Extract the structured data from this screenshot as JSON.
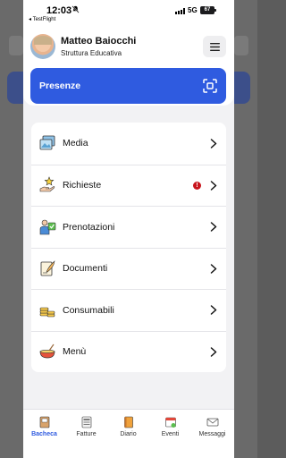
{
  "status_bar": {
    "time": "12:03",
    "silent_icon": "bell-slash",
    "back_app": "◂ TestFlight",
    "network": "5G",
    "battery": "67"
  },
  "header": {
    "user_name": "Matteo Baiocchi",
    "user_role": "Struttura Educativa",
    "menu_icon": "hamburger-icon"
  },
  "presence": {
    "label": "Presenze",
    "icon": "qr-scan-icon",
    "color": "#2f5be0"
  },
  "menu": {
    "items": [
      {
        "label": "Media",
        "icon": "photos-icon"
      },
      {
        "label": "Richieste",
        "icon": "star-hand-icon",
        "alert": "!"
      },
      {
        "label": "Prenotazioni",
        "icon": "person-check-icon"
      },
      {
        "label": "Documenti",
        "icon": "document-quill-icon"
      },
      {
        "label": "Consumabili",
        "icon": "coins-icon"
      },
      {
        "label": "Menù",
        "icon": "food-bowl-icon"
      }
    ]
  },
  "tab_bar": {
    "active": "Bacheca",
    "tabs": [
      {
        "label": "Bacheca",
        "icon": "board-icon"
      },
      {
        "label": "Fatture",
        "icon": "invoice-icon"
      },
      {
        "label": "Diario",
        "icon": "diary-icon"
      },
      {
        "label": "Eventi",
        "icon": "calendar-icon"
      },
      {
        "label": "Messaggi",
        "icon": "mail-icon"
      }
    ]
  }
}
